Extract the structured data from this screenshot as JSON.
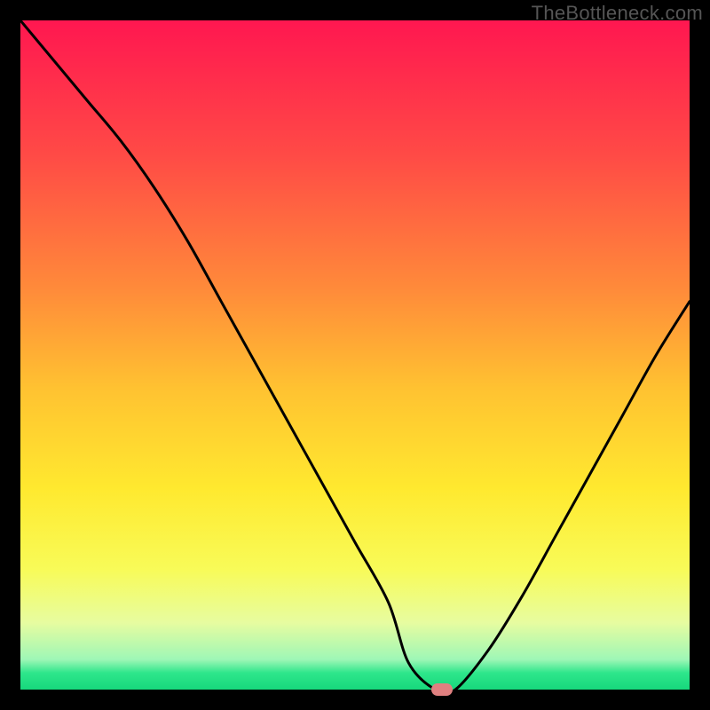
{
  "watermark": "TheBottleneck.com",
  "chart_data": {
    "type": "line",
    "title": "",
    "xlabel": "",
    "ylabel": "",
    "xlim": [
      0,
      100
    ],
    "ylim": [
      0,
      100
    ],
    "grid": false,
    "series": [
      {
        "name": "bottleneck-curve",
        "x": [
          0,
          5,
          10,
          15,
          20,
          25,
          30,
          35,
          40,
          45,
          50,
          55,
          58,
          62,
          65,
          70,
          75,
          80,
          85,
          90,
          95,
          100
        ],
        "values": [
          100,
          94,
          88,
          82,
          75,
          67,
          58,
          49,
          40,
          31,
          22,
          13,
          4,
          0,
          0,
          6,
          14,
          23,
          32,
          41,
          50,
          58
        ]
      }
    ],
    "marker": {
      "x": 63,
      "y": 0
    },
    "background_gradient": {
      "stops": [
        {
          "pos": 0.0,
          "color": "#ff1750"
        },
        {
          "pos": 0.2,
          "color": "#ff4a46"
        },
        {
          "pos": 0.4,
          "color": "#ff8a3a"
        },
        {
          "pos": 0.55,
          "color": "#ffc231"
        },
        {
          "pos": 0.7,
          "color": "#ffe92f"
        },
        {
          "pos": 0.82,
          "color": "#f8fb58"
        },
        {
          "pos": 0.9,
          "color": "#e7fca0"
        },
        {
          "pos": 0.955,
          "color": "#9ef7b6"
        },
        {
          "pos": 0.975,
          "color": "#2ee68b"
        },
        {
          "pos": 1.0,
          "color": "#17d87c"
        }
      ]
    }
  }
}
